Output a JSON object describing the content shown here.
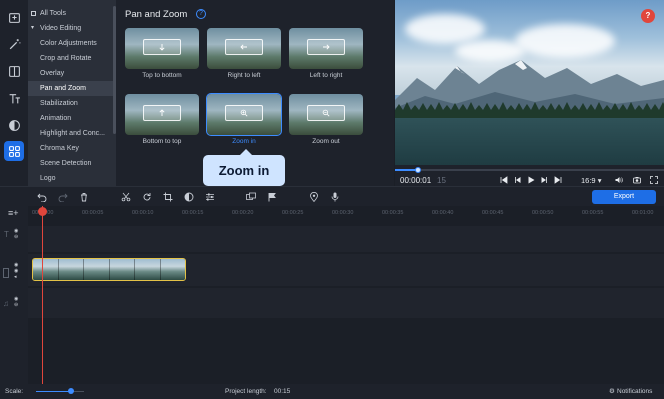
{
  "sidebar": {
    "icons": [
      "import-icon",
      "magic-wand-icon",
      "transitions-icon",
      "titles-icon",
      "filters-icon",
      "more-tools-icon"
    ]
  },
  "categories": {
    "items": [
      "All Tools",
      "Video Editing",
      "Color Adjustments",
      "Crop and Rotate",
      "Overlay",
      "Pan and Zoom",
      "Stabilization",
      "Animation",
      "Highlight and Conc...",
      "Chroma Key",
      "Scene Detection",
      "Logo"
    ],
    "active_index": 5
  },
  "effects": {
    "title": "Pan and Zoom",
    "help": "?",
    "tiles": [
      {
        "label": "Top to bottom",
        "icon": "arrow-down-icon"
      },
      {
        "label": "Right to left",
        "icon": "arrow-left-icon"
      },
      {
        "label": "Left to right",
        "icon": "arrow-right-icon"
      },
      {
        "label": "Bottom to top",
        "icon": "arrow-up-icon"
      },
      {
        "label": "Zoom in",
        "icon": "zoom-in-icon"
      },
      {
        "label": "Zoom out",
        "icon": "zoom-out-icon"
      }
    ],
    "selected": "Zoom in",
    "tooltip": "Zoom in"
  },
  "player": {
    "help_badge": "?",
    "time_current": "00:00:01",
    "time_frame": "15",
    "aspect_ratio": "16:9",
    "progress": 0.08
  },
  "toolbar": {
    "export_label": "Export"
  },
  "ruler": {
    "ticks": [
      "00:00:00",
      "00:00:05",
      "00:00:10",
      "00:00:15",
      "00:00:20",
      "00:00:25",
      "00:00:30",
      "00:00:35",
      "00:00:40",
      "00:00:45",
      "00:00:50",
      "00:00:55",
      "00:01:00"
    ]
  },
  "status": {
    "scale_label": "Scale:",
    "project_length_label": "Project length:",
    "project_length_value": "00:15",
    "notifications_label": "Notifications"
  },
  "colors": {
    "accent": "#1e6ee6",
    "playhead": "#e0463c",
    "clip_border": "#e3c247",
    "tooltip_bg": "#cfe4ff"
  }
}
